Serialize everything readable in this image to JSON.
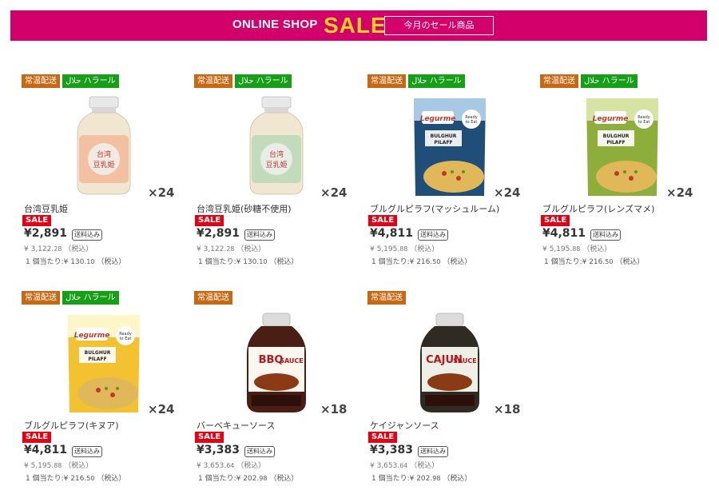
{
  "banner": {
    "online_shop": "ONLINE SHOP",
    "sale": "SALE",
    "box_label": "今月のセール商品"
  },
  "colors": {
    "banner_bg": "#d3006b",
    "sale_yellow": "#ffd21f",
    "temp_tag": "#c86812",
    "halal_tag": "#16a018",
    "sale_badge": "#e60012"
  },
  "products": [
    {
      "tags": [
        "常温配送",
        "حلال ハラール"
      ],
      "image_icon": "soy-milk-bottle-orange",
      "qty": "×24",
      "name": "台湾豆乳姫",
      "sale_badge": "SALE",
      "price": "¥2,891",
      "shipping": "送料込み",
      "orig_main": "¥ 3,122.",
      "orig_dec": "28",
      "orig_tax": "（税込）",
      "unit_main": "1 個当たり:¥ 130.",
      "unit_dec": "10",
      "unit_tax": "（税込）"
    },
    {
      "tags": [
        "常温配送",
        "حلال ハラール"
      ],
      "image_icon": "soy-milk-bottle-green",
      "qty": "×24",
      "name": "台湾豆乳姫(砂糖不使用)",
      "sale_badge": "SALE",
      "price": "¥2,891",
      "shipping": "送料込み",
      "orig_main": "¥ 3,122.",
      "orig_dec": "28",
      "orig_tax": "（税込）",
      "unit_main": "1 個当たり:¥ 130.",
      "unit_dec": "10",
      "unit_tax": "（税込）"
    },
    {
      "tags": [
        "常温配送",
        "حلال ハラール"
      ],
      "image_icon": "pilaf-pouch-blue",
      "qty": "×24",
      "name": "ブルグルピラフ(マッシュルーム)",
      "sale_badge": "SALE",
      "price": "¥4,811",
      "shipping": "送料込み",
      "orig_main": "¥ 5,195.",
      "orig_dec": "88",
      "orig_tax": "（税込）",
      "unit_main": "1 個当たり:¥ 216.",
      "unit_dec": "50",
      "unit_tax": "（税込）"
    },
    {
      "tags": [
        "常温配送",
        "حلال ハラール"
      ],
      "image_icon": "pilaf-pouch-green",
      "qty": "×24",
      "name": "ブルグルピラフ(レンズマメ)",
      "sale_badge": "SALE",
      "price": "¥4,811",
      "shipping": "送料込み",
      "orig_main": "¥ 5,195.",
      "orig_dec": "88",
      "orig_tax": "（税込）",
      "unit_main": "1 個当たり:¥ 216.",
      "unit_dec": "50",
      "unit_tax": "（税込）"
    },
    {
      "tags": [
        "常温配送",
        "حلال ハラール"
      ],
      "image_icon": "pilaf-pouch-yellow",
      "qty": "×24",
      "name": "ブルグルピラフ(キヌア)",
      "sale_badge": "SALE",
      "price": "¥4,811",
      "shipping": "送料込み",
      "orig_main": "¥ 5,195.",
      "orig_dec": "88",
      "orig_tax": "（税込）",
      "unit_main": "1 個当たり:¥ 216.",
      "unit_dec": "50",
      "unit_tax": "（税込）"
    },
    {
      "tags": [
        "常温配送"
      ],
      "image_icon": "bbq-sauce-bottle",
      "qty": "×18",
      "name": "バーベキューソース",
      "sale_badge": "SALE",
      "price": "¥3,383",
      "shipping": "送料込み",
      "orig_main": "¥ 3,653.",
      "orig_dec": "64",
      "orig_tax": "（税込）",
      "unit_main": "1 個当たり:¥ 202.",
      "unit_dec": "98",
      "unit_tax": "（税込）"
    },
    {
      "tags": [
        "常温配送"
      ],
      "image_icon": "cajun-sauce-bottle",
      "qty": "×18",
      "name": "ケイジャンソース",
      "sale_badge": "SALE",
      "price": "¥3,383",
      "shipping": "送料込み",
      "orig_main": "¥ 3,653.",
      "orig_dec": "64",
      "orig_tax": "（税込）",
      "unit_main": "1 個当たり:¥ 202.",
      "unit_dec": "98",
      "unit_tax": "（税込）"
    }
  ]
}
